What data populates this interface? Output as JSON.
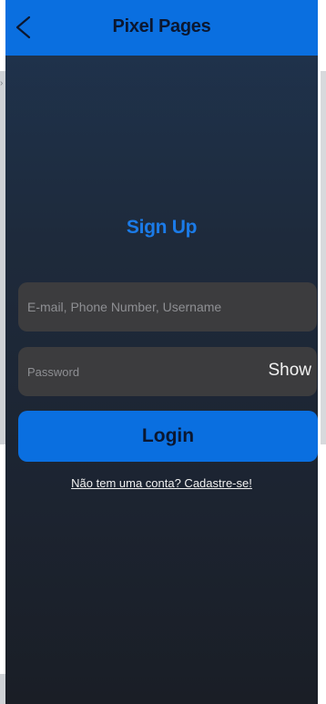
{
  "header": {
    "back_icon": "chevron-left-icon",
    "title": "Pixel Pages"
  },
  "signup": {
    "heading": "Sign Up",
    "email_placeholder": "E-mail, Phone Number, Username",
    "password_placeholder": "Password",
    "show_label": "Show",
    "login_label": "Login",
    "register_link": "Não tem uma conta? Cadastre-se!"
  },
  "colors": {
    "accent": "#0a6fe0",
    "heading": "#1b7be8",
    "field_bg": "#3c3c3e",
    "bg_top": "#1f3450",
    "bg_bottom": "#1a1e26"
  }
}
